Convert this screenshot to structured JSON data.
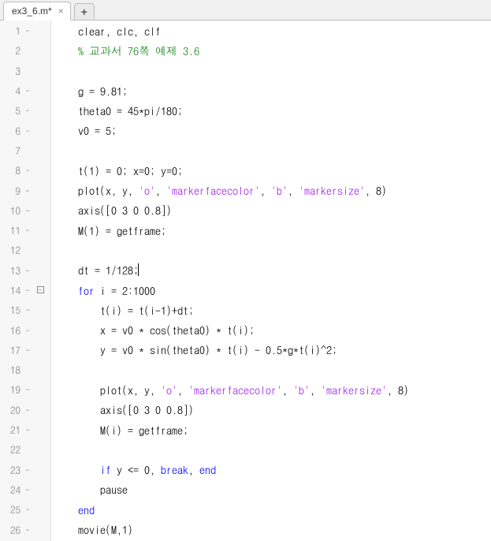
{
  "tabs": {
    "active": {
      "label": "ex3_6.m*"
    },
    "new_tooltip": "New"
  },
  "gutter": [
    {
      "n": "1",
      "exec": "–",
      "fold": ""
    },
    {
      "n": "2",
      "exec": "",
      "fold": ""
    },
    {
      "n": "3",
      "exec": "",
      "fold": ""
    },
    {
      "n": "4",
      "exec": "–",
      "fold": ""
    },
    {
      "n": "5",
      "exec": "–",
      "fold": ""
    },
    {
      "n": "6",
      "exec": "–",
      "fold": ""
    },
    {
      "n": "7",
      "exec": "",
      "fold": ""
    },
    {
      "n": "8",
      "exec": "–",
      "fold": ""
    },
    {
      "n": "9",
      "exec": "–",
      "fold": ""
    },
    {
      "n": "10",
      "exec": "–",
      "fold": ""
    },
    {
      "n": "11",
      "exec": "–",
      "fold": ""
    },
    {
      "n": "12",
      "exec": "",
      "fold": ""
    },
    {
      "n": "13",
      "exec": "–",
      "fold": ""
    },
    {
      "n": "14",
      "exec": "–",
      "fold": "minus"
    },
    {
      "n": "15",
      "exec": "–",
      "fold": ""
    },
    {
      "n": "16",
      "exec": "–",
      "fold": ""
    },
    {
      "n": "17",
      "exec": "–",
      "fold": ""
    },
    {
      "n": "18",
      "exec": "",
      "fold": ""
    },
    {
      "n": "19",
      "exec": "–",
      "fold": ""
    },
    {
      "n": "20",
      "exec": "–",
      "fold": ""
    },
    {
      "n": "21",
      "exec": "–",
      "fold": ""
    },
    {
      "n": "22",
      "exec": "",
      "fold": ""
    },
    {
      "n": "23",
      "exec": "–",
      "fold": ""
    },
    {
      "n": "24",
      "exec": "–",
      "fold": ""
    },
    {
      "n": "25",
      "exec": "–",
      "fold": ""
    },
    {
      "n": "26",
      "exec": "–",
      "fold": ""
    }
  ],
  "code": [
    [
      {
        "t": "plain",
        "v": "    clear, clc, clf"
      }
    ],
    [
      {
        "t": "comment",
        "v": "    % 교과서 76쪽 예제 3.6"
      }
    ],
    [
      {
        "t": "plain",
        "v": ""
      }
    ],
    [
      {
        "t": "plain",
        "v": "    g = 9.81;"
      }
    ],
    [
      {
        "t": "plain",
        "v": "    theta0 = 45*pi/180;"
      }
    ],
    [
      {
        "t": "plain",
        "v": "    v0 = 5;"
      }
    ],
    [
      {
        "t": "plain",
        "v": ""
      }
    ],
    [
      {
        "t": "plain",
        "v": "    t(1) = 0; x=0; y=0;"
      }
    ],
    [
      {
        "t": "plain",
        "v": "    plot(x, y, "
      },
      {
        "t": "string",
        "v": "'o'"
      },
      {
        "t": "plain",
        "v": ", "
      },
      {
        "t": "string",
        "v": "'markerfacecolor'"
      },
      {
        "t": "plain",
        "v": ", "
      },
      {
        "t": "string",
        "v": "'b'"
      },
      {
        "t": "plain",
        "v": ", "
      },
      {
        "t": "string",
        "v": "'markersize'"
      },
      {
        "t": "plain",
        "v": ", 8)"
      }
    ],
    [
      {
        "t": "plain",
        "v": "    axis([0 3 0 0.8])"
      }
    ],
    [
      {
        "t": "plain",
        "v": "    M(1) = getframe;"
      }
    ],
    [
      {
        "t": "plain",
        "v": ""
      }
    ],
    [
      {
        "t": "plain",
        "v": "    dt = 1/128;"
      },
      {
        "t": "cursor",
        "v": ""
      }
    ],
    [
      {
        "t": "plain",
        "v": "    "
      },
      {
        "t": "keyword",
        "v": "for"
      },
      {
        "t": "plain",
        "v": " i = 2:1000"
      }
    ],
    [
      {
        "t": "plain",
        "v": "        t(i) = t(i-1)+dt;"
      }
    ],
    [
      {
        "t": "plain",
        "v": "        x = v0 * cos(theta0) * t(i);"
      }
    ],
    [
      {
        "t": "plain",
        "v": "        y = v0 * sin(theta0) * t(i) - 0.5*g*t(i)^2;"
      }
    ],
    [
      {
        "t": "plain",
        "v": ""
      }
    ],
    [
      {
        "t": "plain",
        "v": "        plot(x, y, "
      },
      {
        "t": "string",
        "v": "'o'"
      },
      {
        "t": "plain",
        "v": ", "
      },
      {
        "t": "string",
        "v": "'markerfacecolor'"
      },
      {
        "t": "plain",
        "v": ", "
      },
      {
        "t": "string",
        "v": "'b'"
      },
      {
        "t": "plain",
        "v": ", "
      },
      {
        "t": "string",
        "v": "'markersize'"
      },
      {
        "t": "plain",
        "v": ", 8)"
      }
    ],
    [
      {
        "t": "plain",
        "v": "        axis([0 3 0 0.8])"
      }
    ],
    [
      {
        "t": "plain",
        "v": "        M(i) = getframe;"
      }
    ],
    [
      {
        "t": "plain",
        "v": ""
      }
    ],
    [
      {
        "t": "plain",
        "v": "        "
      },
      {
        "t": "keyword",
        "v": "if"
      },
      {
        "t": "plain",
        "v": " y <= 0, "
      },
      {
        "t": "keyword",
        "v": "break"
      },
      {
        "t": "plain",
        "v": ", "
      },
      {
        "t": "keyword",
        "v": "end"
      }
    ],
    [
      {
        "t": "plain",
        "v": "        pause"
      }
    ],
    [
      {
        "t": "plain",
        "v": "    "
      },
      {
        "t": "keyword",
        "v": "end"
      }
    ],
    [
      {
        "t": "plain",
        "v": "    movie(M,1)"
      }
    ]
  ]
}
